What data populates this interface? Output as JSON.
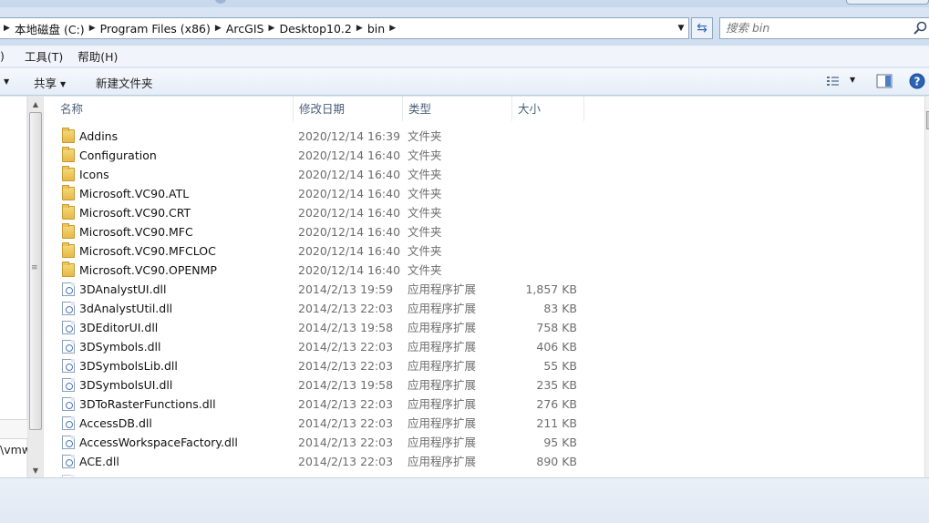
{
  "address": {
    "segments": [
      "本地磁盘 (C:)",
      "Program Files (x86)",
      "ArcGIS",
      "Desktop10.2",
      "bin"
    ]
  },
  "search": {
    "placeholder": "搜索 bin"
  },
  "menu": {
    "items": [
      ")",
      "工具(T)",
      "帮助(H)"
    ]
  },
  "toolbar": {
    "share_label": "共享",
    "new_folder_label": "新建文件夹"
  },
  "left_pane": {
    "path_fragment": "\\vmw"
  },
  "columns": {
    "name": "名称",
    "date": "修改日期",
    "type": "类型",
    "size": "大小"
  },
  "files": [
    {
      "name": "Addins",
      "date": "2020/12/14 16:39",
      "type": "文件夹",
      "size": "",
      "kind": "folder-icon"
    },
    {
      "name": "Configuration",
      "date": "2020/12/14 16:40",
      "type": "文件夹",
      "size": "",
      "kind": "folder-icon"
    },
    {
      "name": "Icons",
      "date": "2020/12/14 16:40",
      "type": "文件夹",
      "size": "",
      "kind": "folder-icon"
    },
    {
      "name": "Microsoft.VC90.ATL",
      "date": "2020/12/14 16:40",
      "type": "文件夹",
      "size": "",
      "kind": "folder-icon"
    },
    {
      "name": "Microsoft.VC90.CRT",
      "date": "2020/12/14 16:40",
      "type": "文件夹",
      "size": "",
      "kind": "folder-icon"
    },
    {
      "name": "Microsoft.VC90.MFC",
      "date": "2020/12/14 16:40",
      "type": "文件夹",
      "size": "",
      "kind": "folder-icon"
    },
    {
      "name": "Microsoft.VC90.MFCLOC",
      "date": "2020/12/14 16:40",
      "type": "文件夹",
      "size": "",
      "kind": "folder-icon"
    },
    {
      "name": "Microsoft.VC90.OPENMP",
      "date": "2020/12/14 16:40",
      "type": "文件夹",
      "size": "",
      "kind": "folder-icon"
    },
    {
      "name": "3DAnalystUI.dll",
      "date": "2014/2/13 19:59",
      "type": "应用程序扩展",
      "size": "1,857 KB",
      "kind": "dll-icon"
    },
    {
      "name": "3dAnalystUtil.dll",
      "date": "2014/2/13 22:03",
      "type": "应用程序扩展",
      "size": "83 KB",
      "kind": "dll-icon"
    },
    {
      "name": "3DEditorUI.dll",
      "date": "2014/2/13 19:58",
      "type": "应用程序扩展",
      "size": "758 KB",
      "kind": "dll-icon"
    },
    {
      "name": "3DSymbols.dll",
      "date": "2014/2/13 22:03",
      "type": "应用程序扩展",
      "size": "406 KB",
      "kind": "dll-icon"
    },
    {
      "name": "3DSymbolsLib.dll",
      "date": "2014/2/13 22:03",
      "type": "应用程序扩展",
      "size": "55 KB",
      "kind": "dll-icon"
    },
    {
      "name": "3DSymbolsUI.dll",
      "date": "2014/2/13 19:58",
      "type": "应用程序扩展",
      "size": "235 KB",
      "kind": "dll-icon"
    },
    {
      "name": "3DToRasterFunctions.dll",
      "date": "2014/2/13 22:03",
      "type": "应用程序扩展",
      "size": "276 KB",
      "kind": "dll-icon"
    },
    {
      "name": "AccessDB.dll",
      "date": "2014/2/13 22:03",
      "type": "应用程序扩展",
      "size": "211 KB",
      "kind": "dll-icon"
    },
    {
      "name": "AccessWorkspaceFactory.dll",
      "date": "2014/2/13 22:03",
      "type": "应用程序扩展",
      "size": "95 KB",
      "kind": "dll-icon"
    },
    {
      "name": "ACE.dll",
      "date": "2014/2/13 22:03",
      "type": "应用程序扩展",
      "size": "890 KB",
      "kind": "dll-icon"
    }
  ]
}
